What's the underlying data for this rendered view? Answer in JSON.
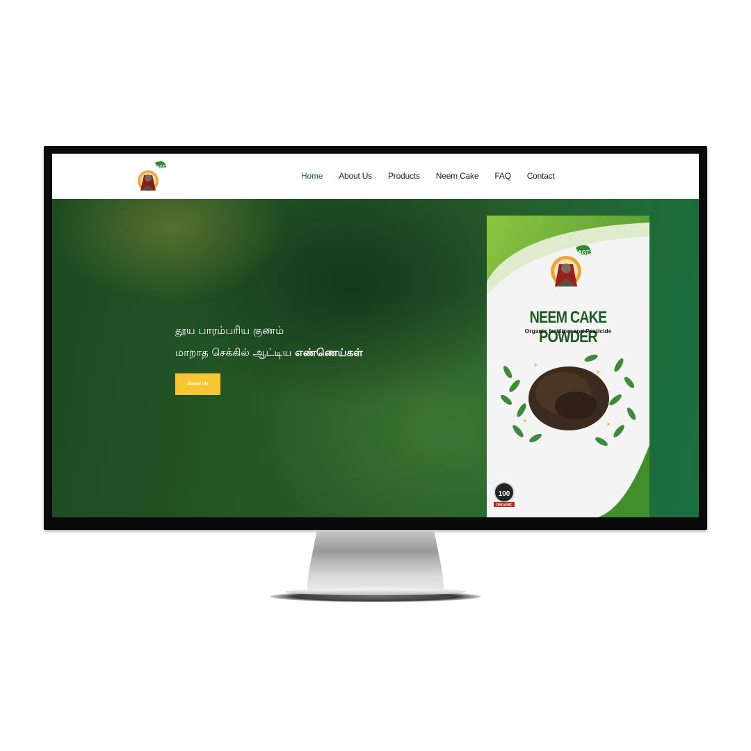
{
  "nav": {
    "links": [
      {
        "label": "Home",
        "active": true
      },
      {
        "label": "About Us"
      },
      {
        "label": "Products"
      },
      {
        "label": "Neem Cake"
      },
      {
        "label": "FAQ"
      },
      {
        "label": "Contact"
      }
    ],
    "logo_badge": "AGT"
  },
  "hero": {
    "line1": "தூய பாரம்பரிய குணம்",
    "line2_regular": "மாறாத செக்கில் ஆட்டிய ",
    "line2_bold": "எண்ணெய்கள்",
    "button_label": "About Us"
  },
  "product": {
    "brand_badge": "AGT",
    "title": "NEEM CAKE POWDER",
    "subtitle": "Organic fertilizer and Pesticide",
    "badge_number": "100",
    "badge_text": "ORGANIC"
  },
  "colors": {
    "nav_active": "#1e6b2c",
    "nav_text": "#1b1b3f",
    "button": "#f7c531",
    "hero_green": "#245626",
    "bag_title": "#1d5a22"
  }
}
